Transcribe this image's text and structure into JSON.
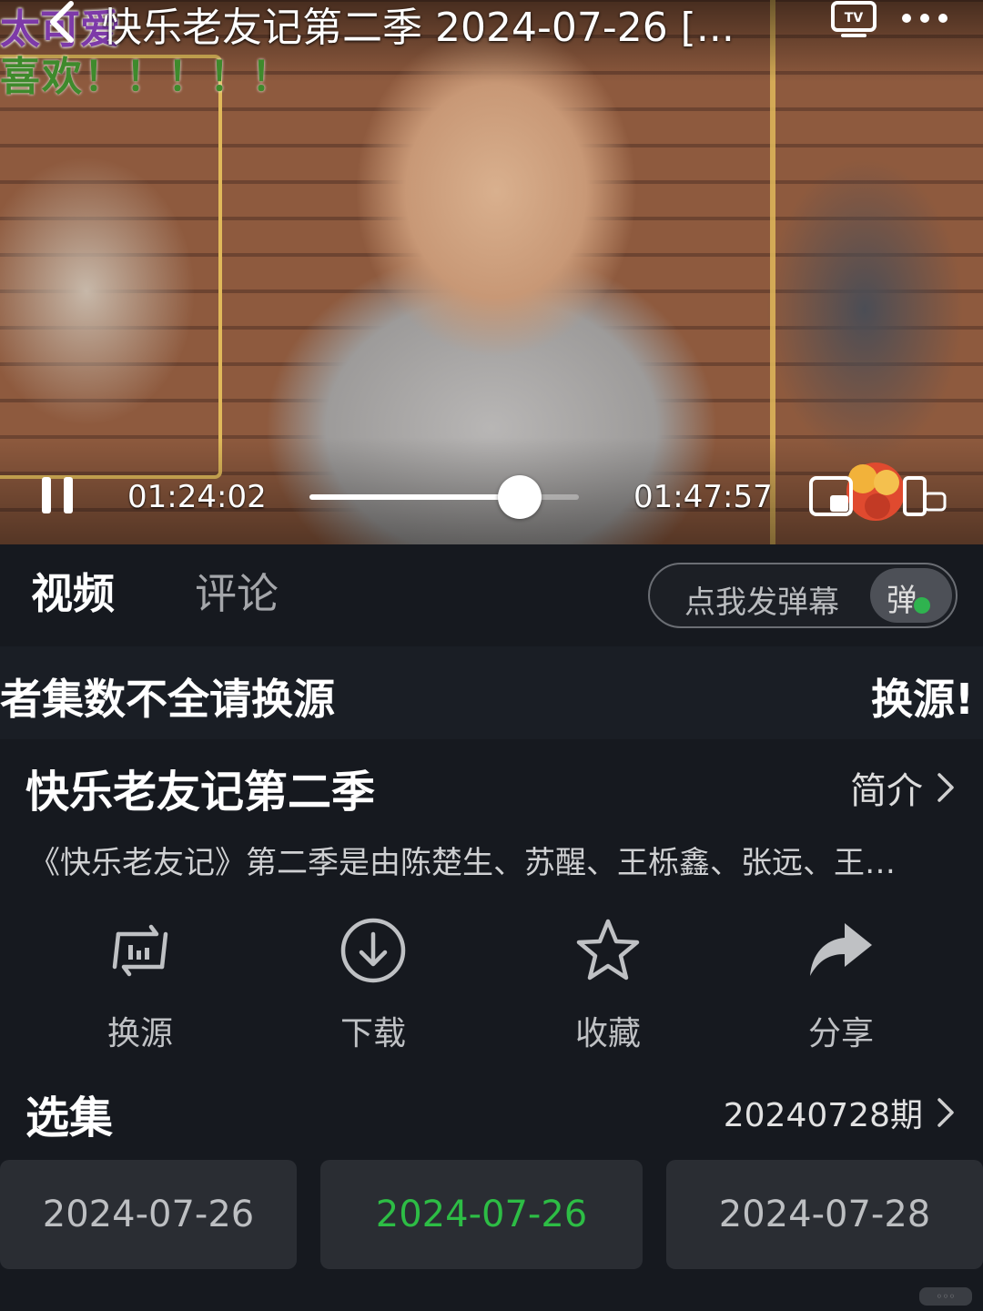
{
  "player": {
    "title": "快乐老友记第二季 2024-07-26 [...",
    "overlay_top": "太可爱",
    "overlay_second": "喜欢！！！！！",
    "current_time": "01:24:02",
    "total_time": "01:47:57",
    "progress_fraction": 0.78,
    "icons": [
      "back-icon",
      "tv-cast-icon",
      "more-icon",
      "pause-icon",
      "picture-in-picture-icon",
      "rotate-screen-icon"
    ]
  },
  "tabs": [
    {
      "label": "视频",
      "active": true
    },
    {
      "label": "评论",
      "active": false
    }
  ],
  "danmu": {
    "placeholder": "点我发弹幕",
    "button": "弹"
  },
  "notice": {
    "left": "者集数不全请换源",
    "right": "换源!"
  },
  "show": {
    "title": "快乐老友记第二季",
    "intro_label": "简介",
    "description": "《快乐老友记》第二季是由陈楚生、苏醒、王栎鑫、张远、王…"
  },
  "actions": [
    {
      "label": "换源",
      "icon": "switch-source-icon"
    },
    {
      "label": "下载",
      "icon": "download-icon"
    },
    {
      "label": "收藏",
      "icon": "favorite-star-icon"
    },
    {
      "label": "分享",
      "icon": "share-icon"
    }
  ],
  "episodes": {
    "title": "选集",
    "current_label": "20240728期",
    "items": [
      {
        "label": "2024-07-26",
        "selected": false
      },
      {
        "label": "2024-07-26",
        "selected": true
      },
      {
        "label": "2024-07-28",
        "selected": false
      }
    ]
  },
  "colors": {
    "background": "#16191f",
    "accent_green": "#2dbd45",
    "button_bg": "#2a2d33"
  }
}
